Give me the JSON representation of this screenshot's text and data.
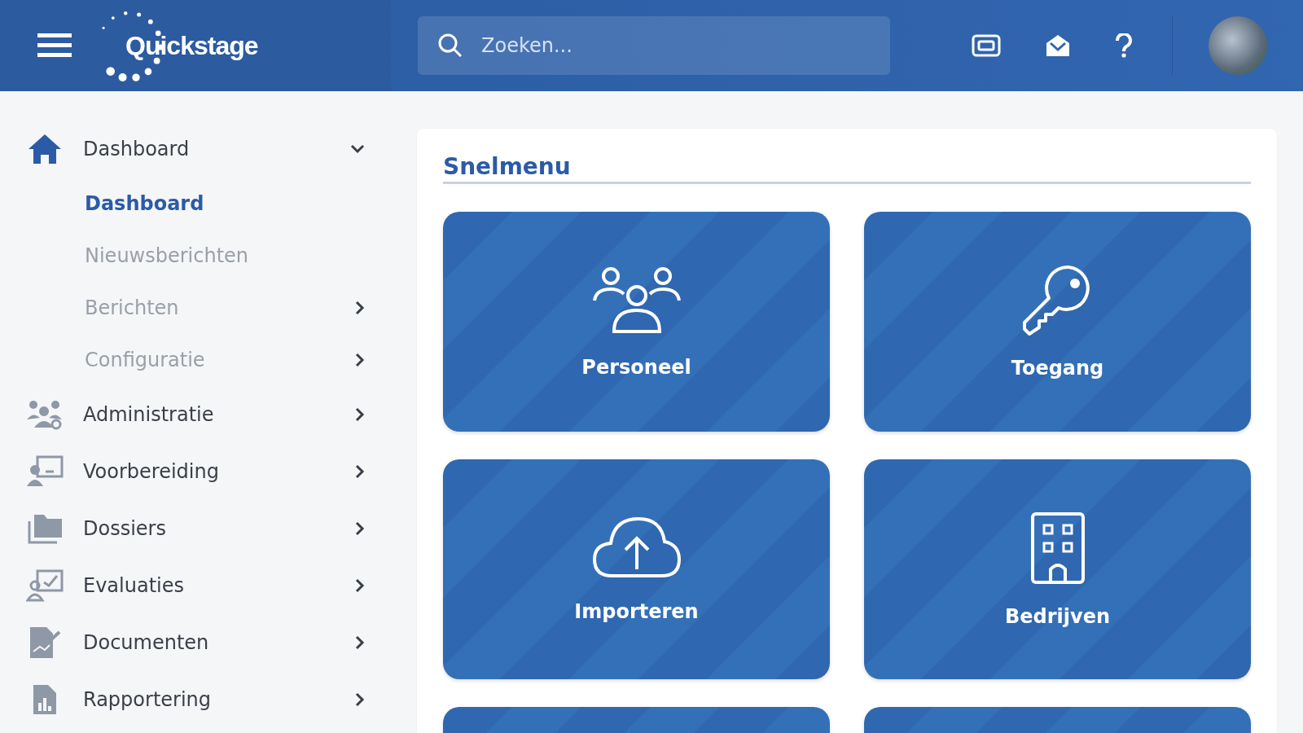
{
  "header": {
    "logo": "Quickstage",
    "search": {
      "placeholder": "Zoeken..."
    }
  },
  "sidebar": {
    "items": [
      {
        "label": "Dashboard",
        "kind": "home",
        "expanded": true,
        "children": [
          {
            "label": "Dashboard",
            "selected": true,
            "kind": "link"
          },
          {
            "label": "Nieuwsberichten",
            "selected": false,
            "kind": "link"
          },
          {
            "label": "Berichten",
            "selected": false,
            "expanded": false,
            "kind": "group"
          },
          {
            "label": "Configuratie",
            "selected": false,
            "expanded": false,
            "kind": "group"
          }
        ]
      },
      {
        "label": "Administratie",
        "kind": "people",
        "expanded": false
      },
      {
        "label": "Voorbereiding",
        "kind": "presenter",
        "expanded": false
      },
      {
        "label": "Dossiers",
        "kind": "folder",
        "expanded": false
      },
      {
        "label": "Evaluaties",
        "kind": "evaluation",
        "expanded": false
      },
      {
        "label": "Documenten",
        "kind": "document",
        "expanded": false
      },
      {
        "label": "Rapportering",
        "kind": "report",
        "expanded": false
      }
    ]
  },
  "quick_menu": {
    "title": "Snelmenu",
    "tiles": [
      {
        "label": "Personeel",
        "kind": "people"
      },
      {
        "label": "Toegang",
        "kind": "key"
      },
      {
        "label": "Importeren",
        "kind": "upload"
      },
      {
        "label": "Bedrijven",
        "kind": "building"
      },
      {
        "kind": "cut-off"
      },
      {
        "kind": "cut-off"
      }
    ]
  }
}
